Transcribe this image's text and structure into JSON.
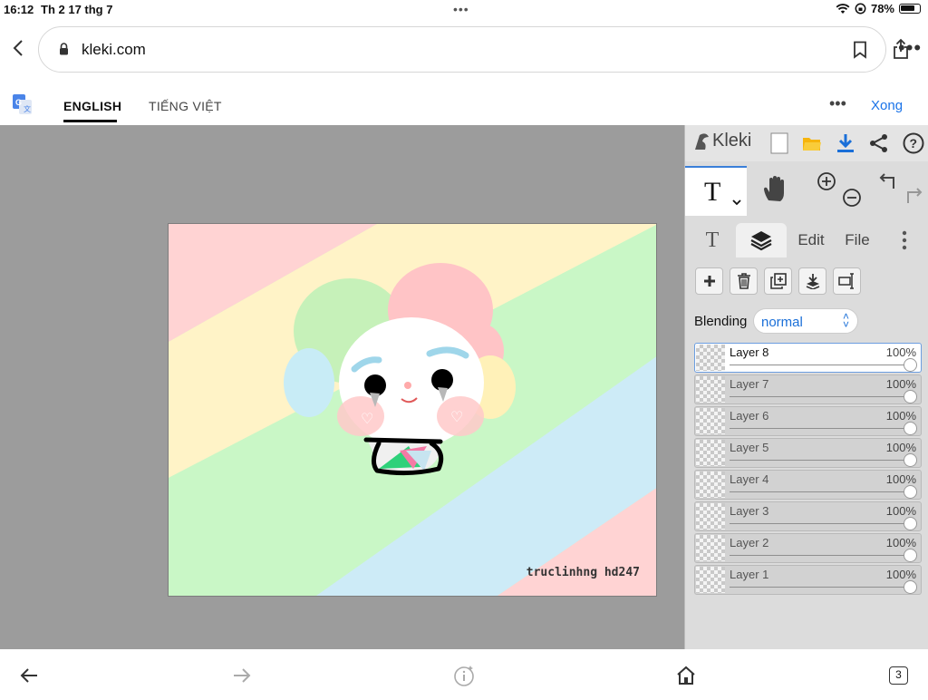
{
  "status": {
    "time": "16:12",
    "date": "Th 2 17 thg 7",
    "battery": "78%",
    "battery_level": 0.78
  },
  "browser": {
    "url": "kleki.com",
    "icons": [
      "chevron-left-icon",
      "lock-icon",
      "bookmark-icon",
      "share-icon",
      "more-icon"
    ]
  },
  "translate": {
    "tab_english": "ENGLISH",
    "tab_vietnamese": "TIẾNG VIỆT",
    "done": "Xong"
  },
  "canvas": {
    "signature": "truclinhng hd247",
    "colors": {
      "pink": "#ffd3d3",
      "yellow": "#fff3c7",
      "green": "#c9f7c6",
      "blue": "#cdebf7"
    }
  },
  "kleki": {
    "logo": "Kleki",
    "tabs": {
      "edit": "Edit",
      "file": "File"
    },
    "blending_label": "Blending",
    "blending_value": "normal",
    "layers": [
      {
        "name": "Layer 8",
        "opacity": "100%",
        "active": true
      },
      {
        "name": "Layer 7",
        "opacity": "100%",
        "active": false
      },
      {
        "name": "Layer 6",
        "opacity": "100%",
        "active": false
      },
      {
        "name": "Layer 5",
        "opacity": "100%",
        "active": false
      },
      {
        "name": "Layer 4",
        "opacity": "100%",
        "active": false
      },
      {
        "name": "Layer 3",
        "opacity": "100%",
        "active": false
      },
      {
        "name": "Layer 2",
        "opacity": "100%",
        "active": false
      },
      {
        "name": "Layer 1",
        "opacity": "100%",
        "active": false
      }
    ],
    "accent": "#1a6fd8"
  },
  "bottom": {
    "tab_count": "3"
  }
}
